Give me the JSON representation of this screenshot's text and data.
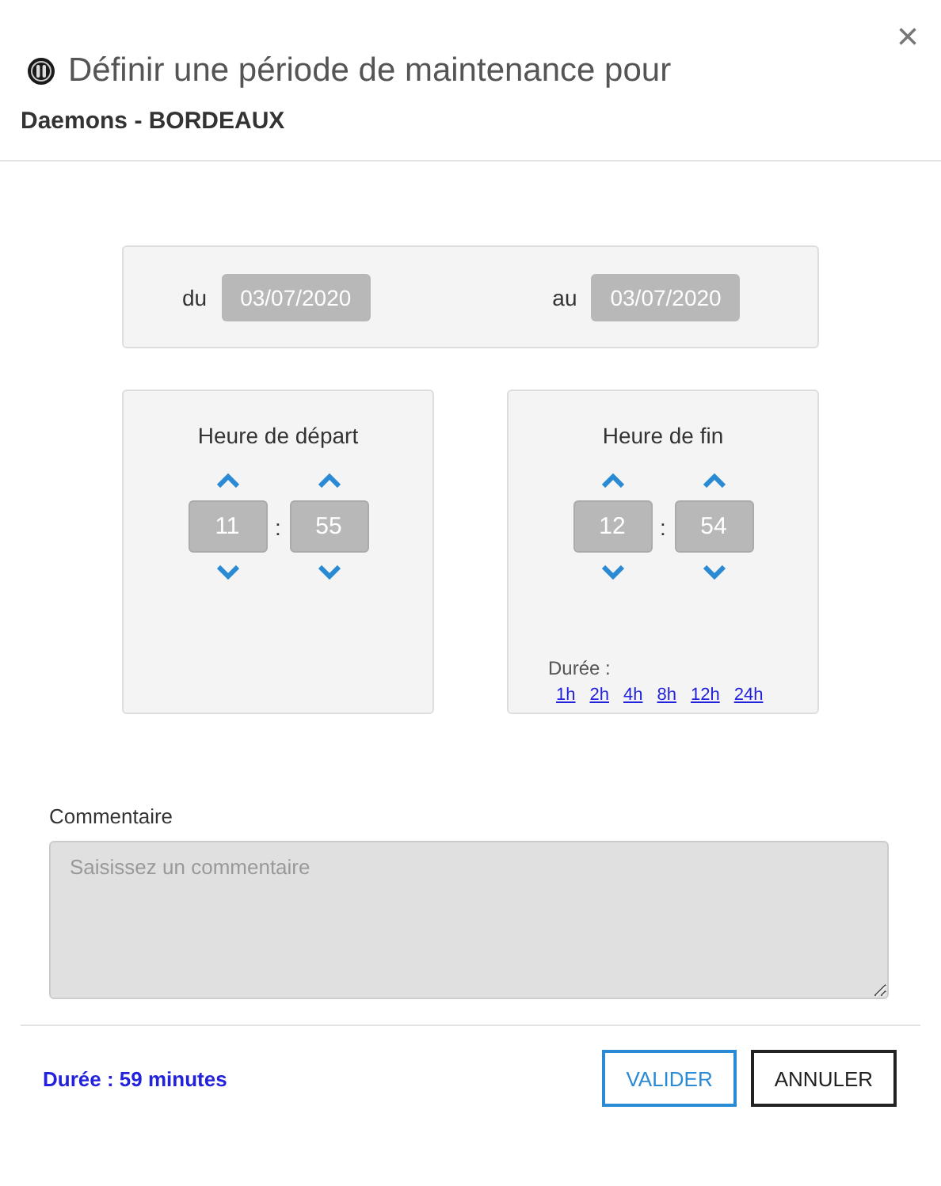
{
  "header": {
    "close": "×",
    "title": "Définir une période de maintenance pour",
    "subtitle": "Daemons - BORDEAUX"
  },
  "dates": {
    "from_label": "du",
    "from": "03/07/2020",
    "to_label": "au",
    "to": "03/07/2020"
  },
  "time_cards": [
    {
      "title": "Heure de départ",
      "hours": "11",
      "separator": ":",
      "minutes": "55"
    },
    {
      "title": "Heure de fin",
      "hours": "12",
      "separator": ":",
      "minutes": "54",
      "durations_label": "Durée :",
      "durations": [
        "1h",
        "2h",
        "4h",
        "8h",
        "12h",
        "24h"
      ]
    }
  ],
  "comment": {
    "label": "Commentaire",
    "placeholder": "Saisissez un commentaire"
  },
  "footer": {
    "duration": "Durée : 59 minutes",
    "buttons": [
      {
        "label": "VALIDER",
        "kind": "primary"
      },
      {
        "label": "ANNULER",
        "kind": "secondary"
      }
    ]
  }
}
